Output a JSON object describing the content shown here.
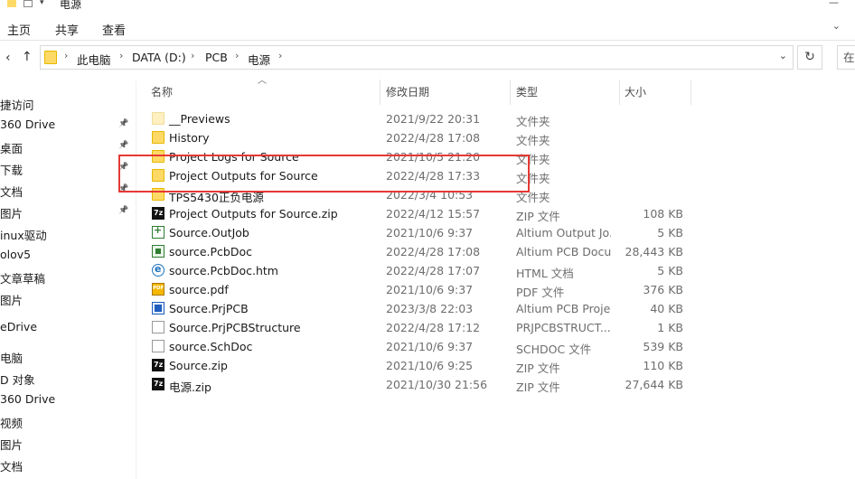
{
  "window": {
    "title": "电源"
  },
  "ribbon": {
    "tabs": [
      "主页",
      "共享",
      "查看"
    ]
  },
  "address": {
    "segments": [
      "此电脑",
      "DATA (D:)",
      "PCB",
      "电源"
    ],
    "search_placeholder": "在"
  },
  "sidebar": {
    "items": [
      {
        "label": "捷访问",
        "pinned": false
      },
      {
        "label": "360 Drive",
        "pinned": true
      },
      {
        "label": "桌面",
        "pinned": true
      },
      {
        "label": "下载",
        "pinned": true
      },
      {
        "label": "文档",
        "pinned": true
      },
      {
        "label": "图片",
        "pinned": true
      },
      {
        "label": "inux驱动",
        "pinned": false
      },
      {
        "label": "olov5",
        "pinned": false
      },
      {
        "label": "文章草稿",
        "pinned": false
      },
      {
        "label": "图片",
        "pinned": false
      },
      {
        "label": "eDrive",
        "pinned": false
      },
      {
        "label": "电脑",
        "pinned": false
      },
      {
        "label": "D 对象",
        "pinned": false
      },
      {
        "label": "360 Drive",
        "pinned": false
      },
      {
        "label": "视频",
        "pinned": false
      },
      {
        "label": "图片",
        "pinned": false
      },
      {
        "label": "文档",
        "pinned": false
      }
    ]
  },
  "columns": {
    "name": "名称",
    "date": "修改日期",
    "type": "类型",
    "size": "大小"
  },
  "files": [
    {
      "name": "__Previews",
      "date": "2021/9/22 20:31",
      "type": "文件夹",
      "size": "",
      "icon": "folder-faded-icon"
    },
    {
      "name": "History",
      "date": "2022/4/28 17:08",
      "type": "文件夹",
      "size": "",
      "icon": "folder-icon"
    },
    {
      "name": "Project Logs for Source",
      "date": "2021/10/5 21:20",
      "type": "文件夹",
      "size": "",
      "icon": "folder-icon"
    },
    {
      "name": "Project Outputs for Source",
      "date": "2022/4/28 17:33",
      "type": "文件夹",
      "size": "",
      "icon": "folder-icon"
    },
    {
      "name": "TPS5430正负电源",
      "date": "2022/3/4 10:53",
      "type": "文件夹",
      "size": "",
      "icon": "folder-icon"
    },
    {
      "name": "Project Outputs for Source.zip",
      "date": "2022/4/12 15:57",
      "type": "ZIP 文件",
      "size": "108 KB",
      "icon": "7z-archive-icon"
    },
    {
      "name": "Source.OutJob",
      "date": "2021/10/6 9:37",
      "type": "Altium Output Jo...",
      "size": "5 KB",
      "icon": "outjob-icon"
    },
    {
      "name": "source.PcbDoc",
      "date": "2022/4/28 17:08",
      "type": "Altium PCB Docu...",
      "size": "28,443 KB",
      "icon": "altium-pcb-icon"
    },
    {
      "name": "source.PcbDoc.htm",
      "date": "2022/4/28 17:07",
      "type": "HTML 文档",
      "size": "5 KB",
      "icon": "html-document-icon"
    },
    {
      "name": "source.pdf",
      "date": "2021/10/6 9:37",
      "type": "PDF 文件",
      "size": "376 KB",
      "icon": "pdf-icon"
    },
    {
      "name": "Source.PrjPCB",
      "date": "2023/3/8 22:03",
      "type": "Altium PCB Proje...",
      "size": "40 KB",
      "icon": "altium-project-icon"
    },
    {
      "name": "Source.PrjPCBStructure",
      "date": "2022/4/28 17:12",
      "type": "PRJPCBSTRUCT...",
      "size": "1 KB",
      "icon": "generic-file-icon"
    },
    {
      "name": "source.SchDoc",
      "date": "2021/10/6 9:37",
      "type": "SCHDOC 文件",
      "size": "539 KB",
      "icon": "generic-file-icon"
    },
    {
      "name": "Source.zip",
      "date": "2021/10/6 9:25",
      "type": "ZIP 文件",
      "size": "110 KB",
      "icon": "7z-archive-icon"
    },
    {
      "name": "电源.zip",
      "date": "2021/10/30 21:56",
      "type": "ZIP 文件",
      "size": "27,644 KB",
      "icon": "7z-archive-icon"
    }
  ],
  "annotation": {
    "color": "#e53935"
  }
}
